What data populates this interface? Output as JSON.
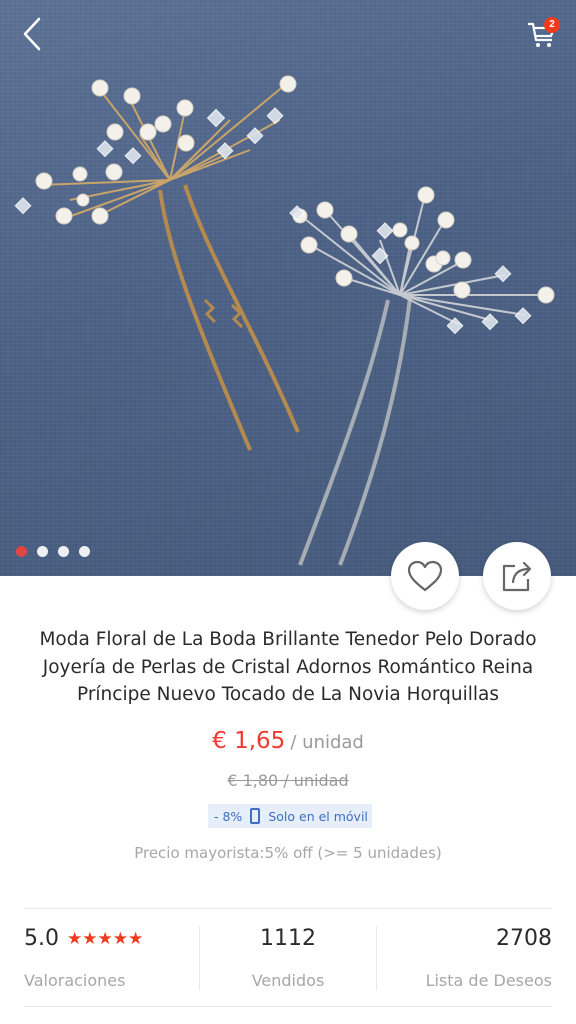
{
  "header": {
    "back_icon": "chevron-left-icon",
    "cart_icon": "cart-icon",
    "cart_count": "2"
  },
  "gallery": {
    "image_description_icon": "product-photo",
    "total_images": 4,
    "active_index": 0
  },
  "actions": {
    "wishlist_icon": "heart-icon",
    "share_icon": "share-icon"
  },
  "product": {
    "title": "Moda Floral de La Boda Brillante Tenedor Pelo Dorado Joyería de Perlas de Cristal Adornos Romántico Reina Príncipe Nuevo Tocado de La Novia Horquillas",
    "price": "€ 1,65",
    "price_unit": "/ unidad",
    "old_price": "€ 1,80  / unidad",
    "discount": "- 8%",
    "mobile_only": "Solo en el móvil",
    "wholesale": "Precio mayorista:5% off (>= 5 unidades)"
  },
  "stats": {
    "rating": "5.0",
    "stars": "★★★★★",
    "rating_label": "Valoraciones",
    "sold": "1112",
    "sold_label": "Vendidos",
    "wishlist": "2708",
    "wishlist_label": "Lista de Deseos"
  },
  "colors": {
    "accent": "#f03a2f",
    "promo_blue": "#3d6fbe",
    "muted": "#a7a7a7"
  }
}
